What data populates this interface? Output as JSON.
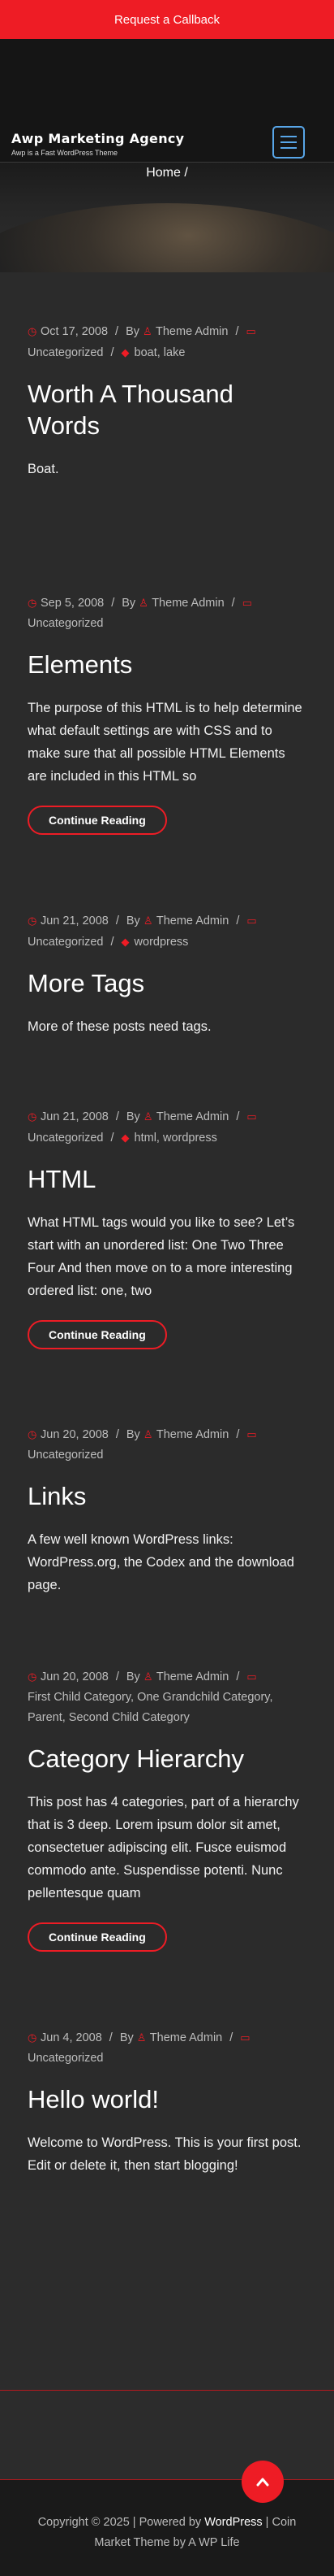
{
  "topbar": {
    "callback_label": "Request a Callback"
  },
  "brand": {
    "title": "Awp Marketing Agency",
    "tagline": "Awp is a Fast WordPress Theme"
  },
  "hero": {
    "breadcrumb": "Home /"
  },
  "posts": [
    {
      "date": "Oct 17, 2008",
      "by": "By",
      "author": "Theme Admin",
      "categories": "Uncategorized",
      "tags": "boat, lake",
      "title": "Worth A Thousand Words",
      "excerpt": "Boat.",
      "button": ""
    },
    {
      "date": "Sep 5, 2008",
      "by": "By",
      "author": "Theme Admin",
      "categories": "Uncategorized",
      "tags": "",
      "title": "Elements",
      "excerpt": "The purpose of this HTML is to help determine what default settings are with CSS and to make sure that all possible HTML Elements are included in this HTML so",
      "button": "Continue Reading"
    },
    {
      "date": "Jun 21, 2008",
      "by": "By",
      "author": "Theme Admin",
      "categories": "Uncategorized",
      "tags": "wordpress",
      "title": "More Tags",
      "excerpt": "More of these posts need tags.",
      "button": ""
    },
    {
      "date": "Jun 21, 2008",
      "by": "By",
      "author": "Theme Admin",
      "categories": "Uncategorized",
      "tags": "html, wordpress",
      "title": "HTML",
      "excerpt": "What HTML tags would you like to see? Let’s start with an unordered list: One Two Three Four And then move on to a more interesting ordered list: one, two",
      "button": "Continue Reading"
    },
    {
      "date": "Jun 20, 2008",
      "by": "By",
      "author": "Theme Admin",
      "categories": "Uncategorized",
      "tags": "",
      "title": "Links",
      "excerpt": "A few well known WordPress links: WordPress.org, the Codex and the download page.",
      "button": ""
    },
    {
      "date": "Jun 20, 2008",
      "by": "By",
      "author": "Theme Admin",
      "categories": "First Child Category, One Grandchild Category, Parent, Second Child Category",
      "tags": "",
      "title": "Category Hierarchy",
      "excerpt": "This post has 4 categories, part of a hierarchy that is 3 deep. Lorem ipsum dolor sit amet, consectetuer adipiscing elit. Fusce euismod commodo ante. Suspendisse potenti. Nunc pellentesque quam",
      "button": "Continue Reading"
    },
    {
      "date": "Jun 4, 2008",
      "by": "By",
      "author": "Theme Admin",
      "categories": "Uncategorized",
      "tags": "",
      "title": "Hello world!",
      "excerpt": "Welcome to WordPress. This is your first post. Edit or delete it, then start blogging!",
      "button": ""
    }
  ],
  "footer": {
    "copyright": "Copyright © 2025 | Powered by",
    "wordpress": "WordPress",
    "theme": "| Coin Market Theme by A WP Life"
  },
  "colors": {
    "accent": "#ee1c25",
    "menu_accent": "#58a6e8",
    "background": "#2b2b2b"
  }
}
